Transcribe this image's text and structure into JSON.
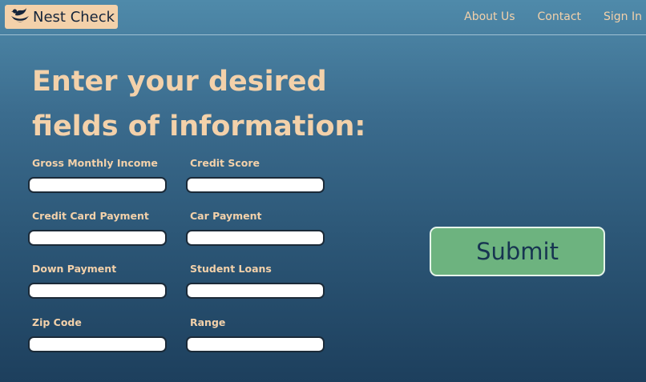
{
  "brand": {
    "name": "Nest Check",
    "logo_icon": "nest-bird-icon",
    "logo_bg": "#f3d1aa"
  },
  "nav": {
    "about": "About Us",
    "contact": "Contact",
    "sign_in": "Sign In"
  },
  "page": {
    "title": "Enter your desired fields of information:"
  },
  "form": {
    "fields": [
      {
        "label": "Gross Monthly Income",
        "value": "",
        "placeholder": ""
      },
      {
        "label": "Credit Score",
        "value": "",
        "placeholder": ""
      },
      {
        "label": "Credit Card Payment",
        "value": "",
        "placeholder": ""
      },
      {
        "label": "Car Payment",
        "value": "",
        "placeholder": ""
      },
      {
        "label": "Down Payment",
        "value": "",
        "placeholder": ""
      },
      {
        "label": "Student Loans",
        "value": "",
        "placeholder": ""
      },
      {
        "label": "Zip Code",
        "value": "",
        "placeholder": ""
      },
      {
        "label": "Range",
        "value": "",
        "placeholder": ""
      }
    ],
    "submit_label": "Submit"
  },
  "colors": {
    "accent_text": "#f3d1aa",
    "submit_bg": "#6db37f",
    "submit_text": "#173451",
    "background_top": "#4f8aaa",
    "background_bottom": "#1d3f5d"
  }
}
